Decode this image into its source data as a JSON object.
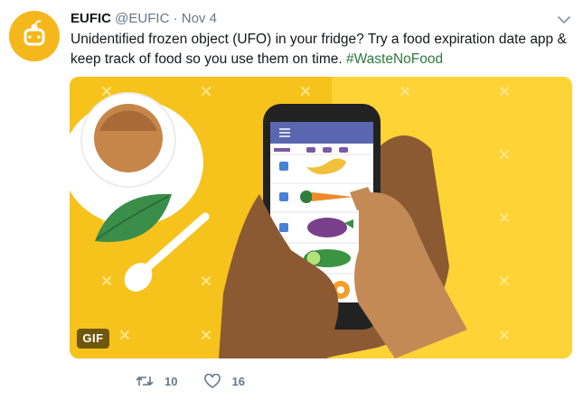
{
  "tweet": {
    "author_name": "EUFIC",
    "author_handle": "@EUFIC",
    "separator": "·",
    "timestamp": "Nov 4",
    "text": "Unidentified frozen object (UFO) in your fridge? Try a food expiration date app & keep track of food so you use them on time. ",
    "hashtag": "#WasteNoFood"
  },
  "media": {
    "badge": "GIF"
  },
  "actions": {
    "retweet_count": "10",
    "like_count": "16"
  },
  "colors": {
    "brand_avatar": "#f5b81c",
    "hashtag": "#2b7a3a",
    "muted": "#657786"
  },
  "icons": [
    "avatar-logo-icon",
    "caret-down-icon",
    "retweet-icon",
    "heart-icon"
  ]
}
